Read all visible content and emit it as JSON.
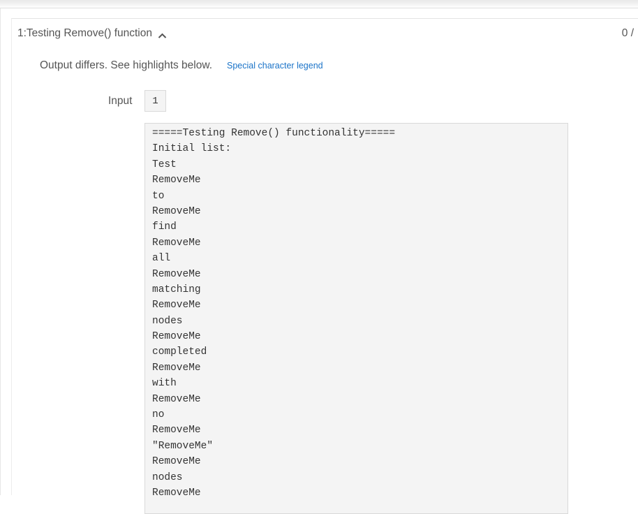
{
  "test_case": {
    "title": "1:Testing Remove() function",
    "score": "0 /",
    "diff_message": "Output differs. See highlights below.",
    "legend_link": "Special character legend",
    "input_label": "Input",
    "input_value": "1",
    "output_lines": [
      "=====Testing Remove() functionality=====",
      "Initial list:",
      "Test",
      "RemoveMe",
      "to",
      "RemoveMe",
      "find",
      "RemoveMe",
      "all",
      "RemoveMe",
      "matching",
      "RemoveMe",
      "nodes",
      "RemoveMe",
      "completed",
      "RemoveMe",
      "with",
      "RemoveMe",
      "no",
      "RemoveMe",
      "\"RemoveMe\"",
      "RemoveMe",
      "nodes",
      "RemoveMe"
    ]
  },
  "icons": {
    "expand_toggle": "chevron-up-icon"
  },
  "colors": {
    "link": "#1a73c8",
    "text": "#555555",
    "code_background": "#f4f4f4",
    "border": "#d9d9d9"
  }
}
